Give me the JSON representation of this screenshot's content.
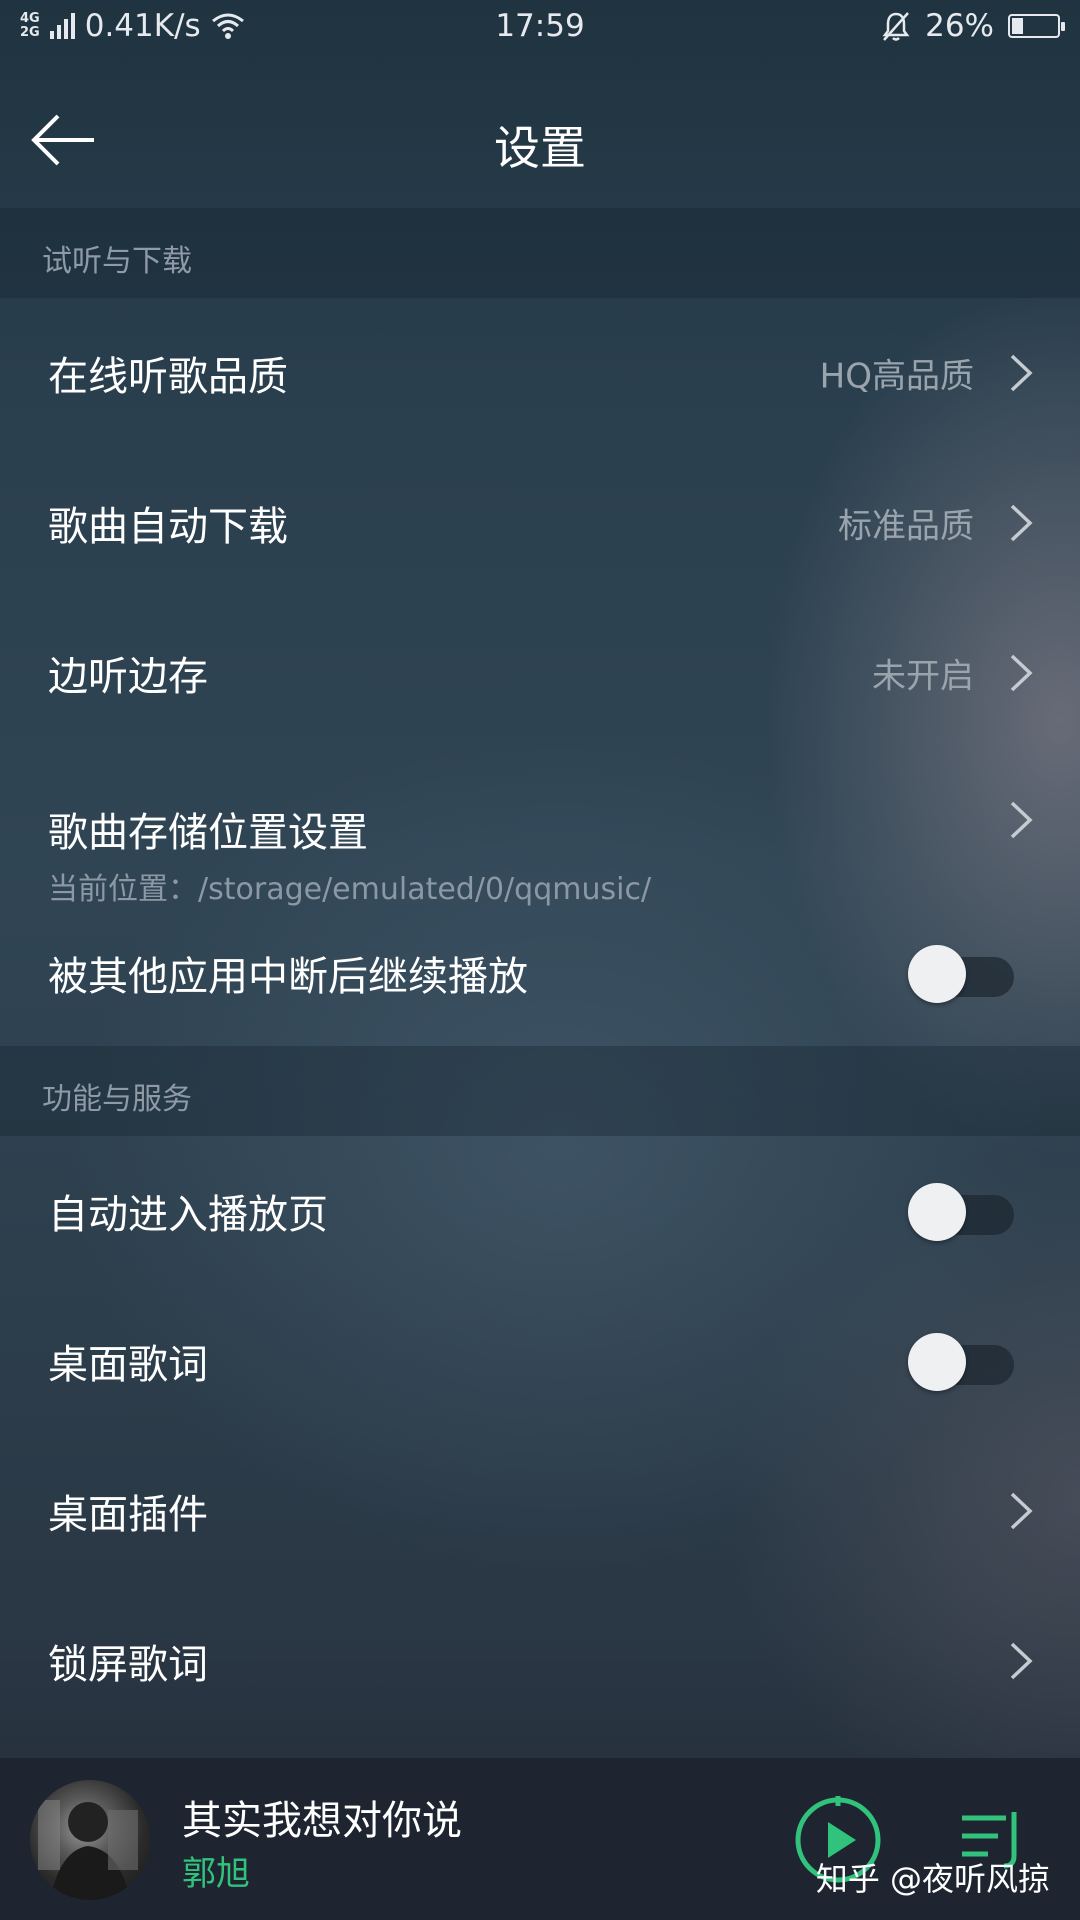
{
  "status_bar": {
    "network_top": "4G",
    "network_bottom": "2G",
    "speed": "0.41K/s",
    "time": "17:59",
    "battery": "26%",
    "battery_level": 0.26
  },
  "header": {
    "title": "设置"
  },
  "sections": [
    {
      "title": "试听与下载",
      "rows": [
        {
          "label": "在线听歌品质",
          "value": "HQ高品质"
        },
        {
          "label": "歌曲自动下载",
          "value": "标准品质"
        },
        {
          "label": "边听边存",
          "value": "未开启"
        },
        {
          "label": "歌曲存储位置设置",
          "sublabel": "当前位置：/storage/emulated/0/qqmusic/"
        },
        {
          "label": "被其他应用中断后继续播放",
          "toggle_on": false
        }
      ]
    },
    {
      "title": "功能与服务",
      "rows": [
        {
          "label": "自动进入播放页",
          "toggle_on": false
        },
        {
          "label": "桌面歌词",
          "toggle_on": false
        },
        {
          "label": "桌面插件"
        },
        {
          "label": "锁屏歌词"
        }
      ]
    }
  ],
  "player": {
    "song_title": "其实我想对你说",
    "artist": "郭旭",
    "accent_color": "#31c27c"
  },
  "watermark": "知乎 @夜听风掠"
}
